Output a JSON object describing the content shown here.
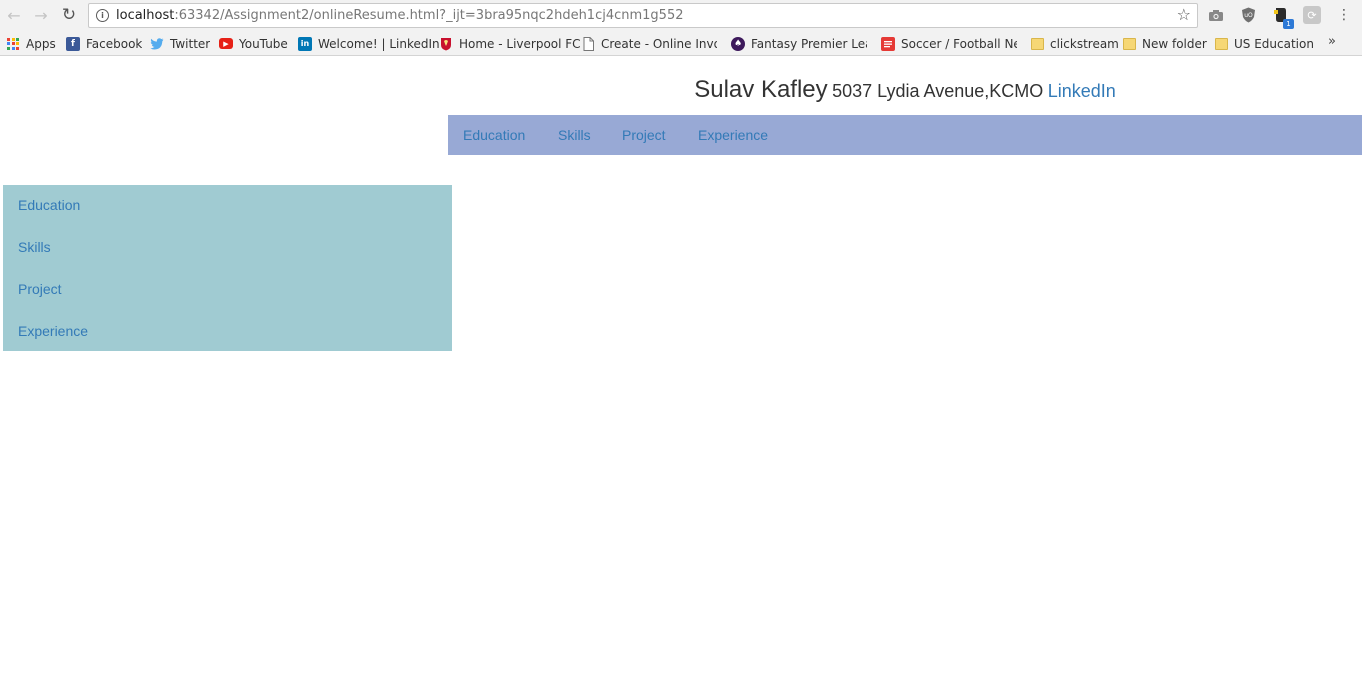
{
  "browser": {
    "url_host": "localhost",
    "url_rest": ":63342/Assignment2/onlineResume.html?_ijt=3bra95nqc2hdeh1cj4cnm1g552",
    "extension_badge": "1",
    "bookmarks": [
      {
        "label": "Apps",
        "icon": "apps-grid-icon"
      },
      {
        "label": "Facebook",
        "icon": "facebook-icon",
        "color": "#3b5998"
      },
      {
        "label": "Twitter",
        "icon": "twitter-icon",
        "color": "#55acee"
      },
      {
        "label": "YouTube",
        "icon": "youtube-icon",
        "color": "#e62117"
      },
      {
        "label": "Welcome! | LinkedIn",
        "icon": "linkedin-icon",
        "color": "#0077b5"
      },
      {
        "label": "Home - Liverpool FC",
        "icon": "liverpool-icon",
        "color": "#c8102e"
      },
      {
        "label": "Create - Online Invoic",
        "icon": "page-icon"
      },
      {
        "label": "Fantasy Premier Leag",
        "icon": "premier-league-icon",
        "color": "#3d195b"
      },
      {
        "label": "Soccer / Football New",
        "icon": "soccer-news-icon",
        "color": "#e53935"
      },
      {
        "label": "clickstream",
        "icon": "folder-icon"
      },
      {
        "label": "New folder",
        "icon": "folder-icon"
      },
      {
        "label": "US Education",
        "icon": "folder-icon"
      }
    ]
  },
  "page": {
    "name": "Sulav Kafley",
    "address": "5037 Lydia Avenue,KCMO",
    "linkedin_label": "LinkedIn",
    "link_color": "#337ab7",
    "topnav_color": "#98a9d5",
    "sidenav_color": "#a0cbd2",
    "topnav": [
      "Education",
      "Skills",
      "Project",
      "Experience"
    ],
    "sidenav": [
      "Education",
      "Skills",
      "Project",
      "Experience"
    ]
  }
}
